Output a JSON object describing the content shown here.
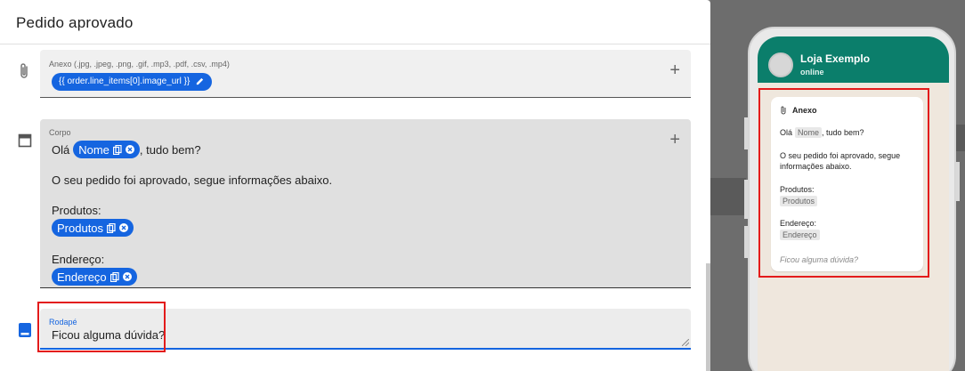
{
  "modal": {
    "title": "Pedido aprovado"
  },
  "attachment": {
    "label": "Anexo (.jpg, .jpeg, .png, .gif, .mp3, .pdf, .csv, .mp4)",
    "value": "{{ order.line_items[0].image_url }}",
    "icon": "paperclip-icon"
  },
  "body_field": {
    "label": "Corpo",
    "greeting_prefix": "Olá",
    "name_chip": "Nome",
    "greeting_suffix": ", tudo bem?",
    "message": "O seu pedido foi aprovado, segue informações abaixo.",
    "products_label": "Produtos:",
    "products_chip": "Produtos",
    "address_label": "Endereço:",
    "address_chip": "Endereço"
  },
  "footer_field": {
    "label": "Rodapé",
    "value": "Ficou alguma dúvida?"
  },
  "preview": {
    "contact_name": "Loja Exemplo",
    "contact_status": "online",
    "attachment_label": "Anexo",
    "greeting_prefix": "Olá",
    "name_tag": "Nome",
    "greeting_suffix": ", tudo bem?",
    "message": "O seu pedido foi aprovado, segue informações abaixo.",
    "products_label": "Produtos:",
    "products_tag": "Produtos",
    "address_label": "Endereço:",
    "address_tag": "Endereço",
    "footer": "Ficou alguma dúvida?"
  },
  "colors": {
    "accent_blue": "#1565e0",
    "whatsapp_green": "#0b7e6b",
    "highlight_red": "#e31b1b"
  }
}
